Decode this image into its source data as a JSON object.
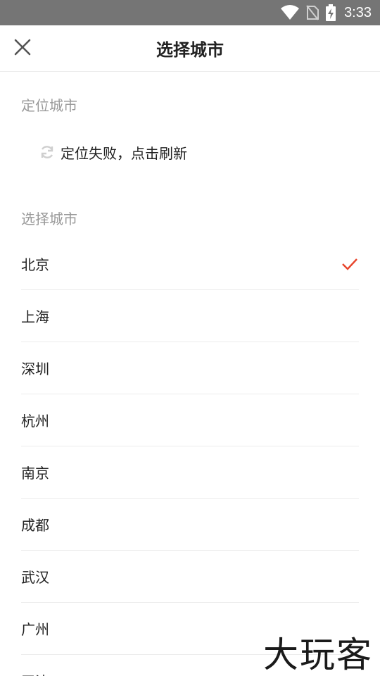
{
  "status_bar": {
    "time": "3:33"
  },
  "header": {
    "title": "选择城市",
    "close_icon": "close-icon"
  },
  "locate_section": {
    "label": "定位城市",
    "status_text": "定位失败，点击刷新",
    "icon": "refresh-icon"
  },
  "select_section": {
    "label": "选择城市",
    "selected_city": "北京",
    "cities": [
      {
        "name": "北京",
        "selected": true
      },
      {
        "name": "上海",
        "selected": false
      },
      {
        "name": "深圳",
        "selected": false
      },
      {
        "name": "杭州",
        "selected": false
      },
      {
        "name": "南京",
        "selected": false
      },
      {
        "name": "成都",
        "selected": false
      },
      {
        "name": "武汉",
        "selected": false
      },
      {
        "name": "广州",
        "selected": false
      },
      {
        "name": "天津",
        "selected": false
      }
    ]
  },
  "watermark": "大玩客",
  "colors": {
    "accent": "#e8452c",
    "status_bar": "#757575",
    "divider": "#ececec",
    "label": "#999999"
  }
}
